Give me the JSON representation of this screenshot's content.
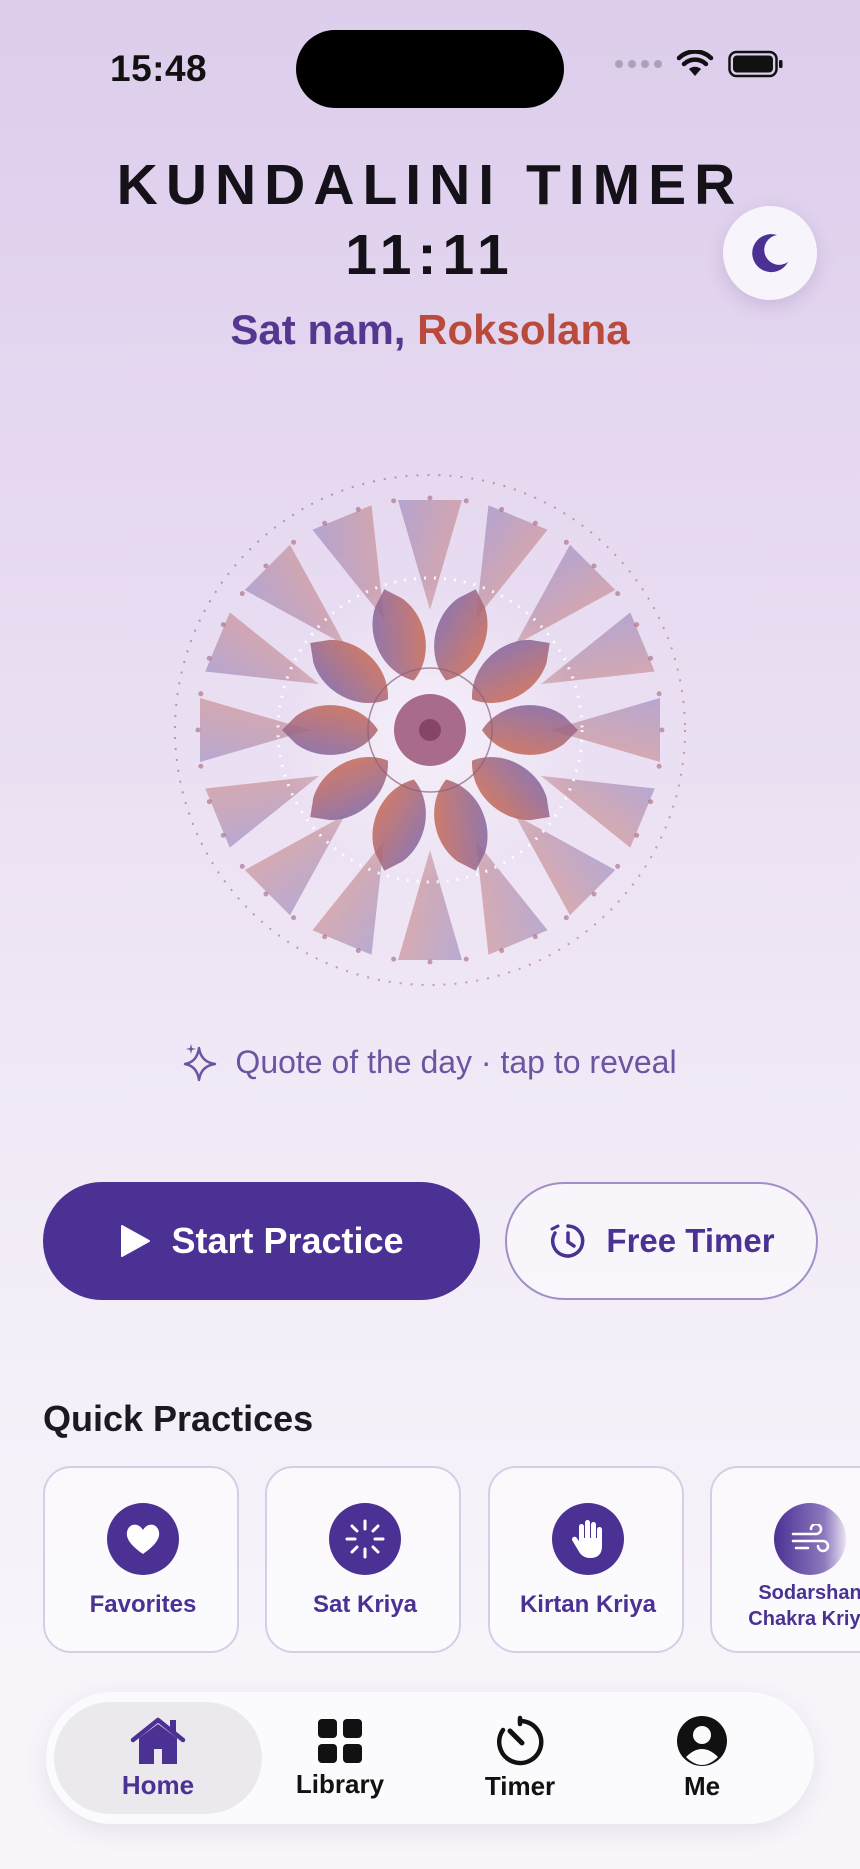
{
  "status_bar": {
    "time": "15:48"
  },
  "header": {
    "title": "KUNDALINI TIMER",
    "time": "11:11",
    "greeting_prefix": "Sat nam, ",
    "greeting_name": "Roksolana"
  },
  "theme_toggle": {
    "icon": "moon-icon"
  },
  "quote": {
    "text": "Quote of the day · tap to reveal",
    "icon": "sparkles-icon"
  },
  "actions": {
    "start_label": "Start Practice",
    "free_timer_label": "Free Timer"
  },
  "quick_practices": {
    "title": "Quick Practices",
    "items": [
      {
        "label": "Favorites",
        "icon": "heart-icon"
      },
      {
        "label": "Sat Kriya",
        "icon": "spark-burst-icon"
      },
      {
        "label": "Kirtan Kriya",
        "icon": "hand-icon"
      },
      {
        "label_line1": "Sodarshan",
        "label_line2": "Chakra Kriya",
        "icon": "wind-icon"
      }
    ]
  },
  "tab_bar": {
    "tabs": [
      {
        "label": "Home",
        "icon": "home-icon",
        "active": true
      },
      {
        "label": "Library",
        "icon": "grid-icon",
        "active": false
      },
      {
        "label": "Timer",
        "icon": "timer-icon",
        "active": false
      },
      {
        "label": "Me",
        "icon": "person-icon",
        "active": false
      }
    ]
  },
  "colors": {
    "accent": "#4b3194",
    "greeting_name": "#b94a3c",
    "mandala_warm": "#c2685a",
    "mandala_cool": "#7b64a8"
  }
}
